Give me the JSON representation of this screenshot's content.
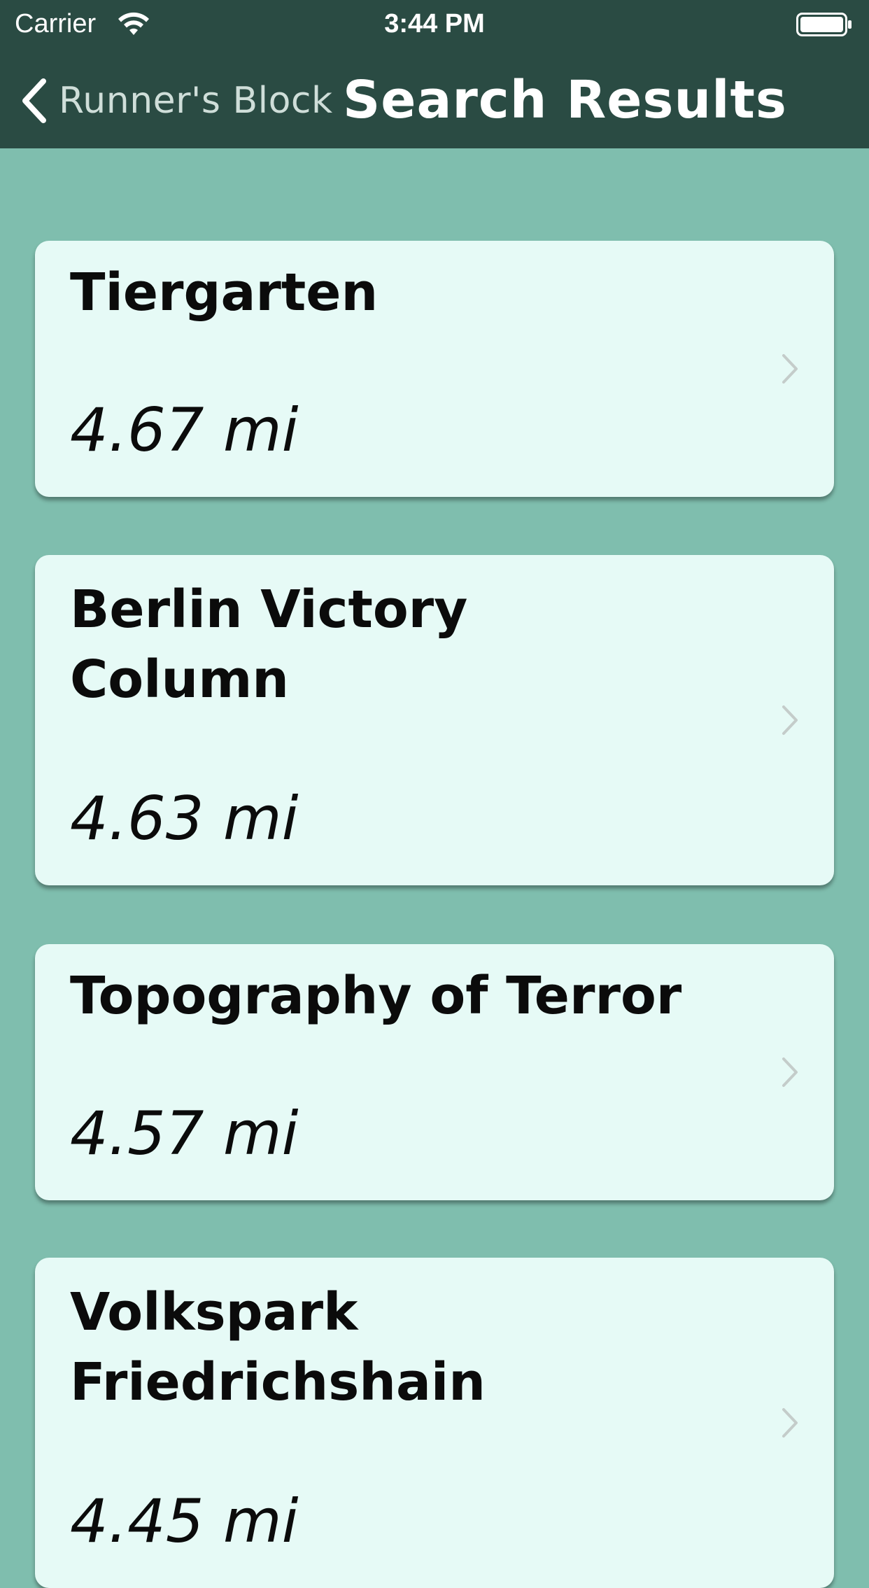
{
  "status_bar": {
    "carrier": "Carrier",
    "time": "3:44 PM",
    "wifi_icon": "wifi-icon",
    "battery_icon": "battery-icon"
  },
  "nav": {
    "back_label": "Runner's Block",
    "back_icon": "chevron-left-icon",
    "title": "Search Results"
  },
  "results": [
    {
      "name": "Tiergarten",
      "distance": "4.67 mi"
    },
    {
      "name": "Berlin Victory Column",
      "distance": "4.63 mi"
    },
    {
      "name": "Topography of Terror",
      "distance": "4.57 mi"
    },
    {
      "name": "Volkspark Friedrichshain",
      "distance": "4.45 mi"
    }
  ],
  "colors": {
    "nav_background": "#2a4b43",
    "page_background": "#7fbeae",
    "card_background": "#e6faf6",
    "back_label": "#cfded9"
  }
}
